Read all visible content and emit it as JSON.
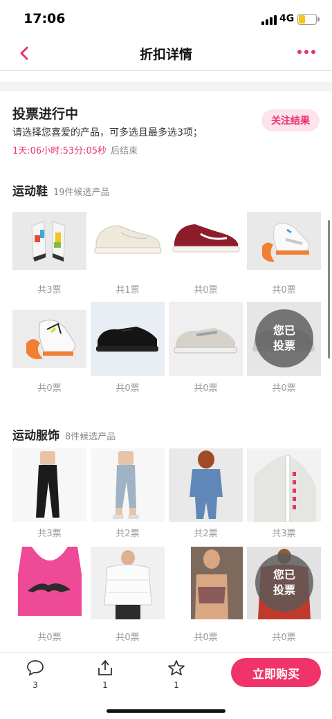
{
  "status_bar": {
    "time": "17:06",
    "network": "4G",
    "battery_level": 0.35,
    "battery_color": "#f5c518"
  },
  "nav": {
    "title": "折扣详情",
    "back_icon": "chevron-left-icon",
    "more_icon": "more-dots-icon",
    "accent": "#e8336b"
  },
  "vote": {
    "title": "投票进行中",
    "description": "请选择您喜爱的产品，可多选且最多选3项；",
    "countdown": "1天:06小时:53分:05秒",
    "countdown_suffix": "后结束",
    "follow_label": "关注结果"
  },
  "sections": [
    {
      "title": "运动鞋",
      "count_label": "19件候选产品",
      "items": [
        {
          "product": "multicolor high-top sneakers",
          "votes_label": "共3票",
          "voted": false
        },
        {
          "product": "cream low-top canvas sneaker",
          "votes_label": "共1票",
          "voted": false
        },
        {
          "product": "burgundy white skate sneaker",
          "votes_label": "共0票",
          "voted": false
        },
        {
          "product": "white basketball sneaker",
          "votes_label": "共0票",
          "voted": false
        },
        {
          "product": "white neon running sneaker",
          "votes_label": "共0票",
          "voted": false
        },
        {
          "product": "black chunky sneaker",
          "votes_label": "共0票",
          "voted": false
        },
        {
          "product": "grey chunky sneaker",
          "votes_label": "共0票",
          "voted": false
        },
        {
          "product": "grey sneaker",
          "votes_label": "共0票",
          "voted": true
        }
      ]
    },
    {
      "title": "运动服饰",
      "count_label": "8件候选产品",
      "items": [
        {
          "product": "black leggings",
          "votes_label": "共3票",
          "voted": false
        },
        {
          "product": "grey cropped leggings",
          "votes_label": "共2票",
          "voted": false
        },
        {
          "product": "denim jacket outfit",
          "votes_label": "共2票",
          "voted": false
        },
        {
          "product": "white high-neck jacket",
          "votes_label": "共3票",
          "voted": false
        },
        {
          "product": "pink sports bra",
          "votes_label": "共0票",
          "voted": false
        },
        {
          "product": "white puffer jacket",
          "votes_label": "共0票",
          "voted": false
        },
        {
          "product": "mauve sports bra",
          "votes_label": "共0票",
          "voted": false
        },
        {
          "product": "red jacket",
          "votes_label": "共0票",
          "voted": true
        }
      ]
    }
  ],
  "voted_badge": {
    "line1": "您已",
    "line2": "投票"
  },
  "bottom_bar": {
    "comment_icon": "comment-bubble-icon",
    "comment_count": "3",
    "share_icon": "share-icon",
    "share_count": "1",
    "favorite_icon": "star-icon",
    "favorite_count": "1",
    "buy_label": "立即购买",
    "buy_color": "#f0336b"
  }
}
